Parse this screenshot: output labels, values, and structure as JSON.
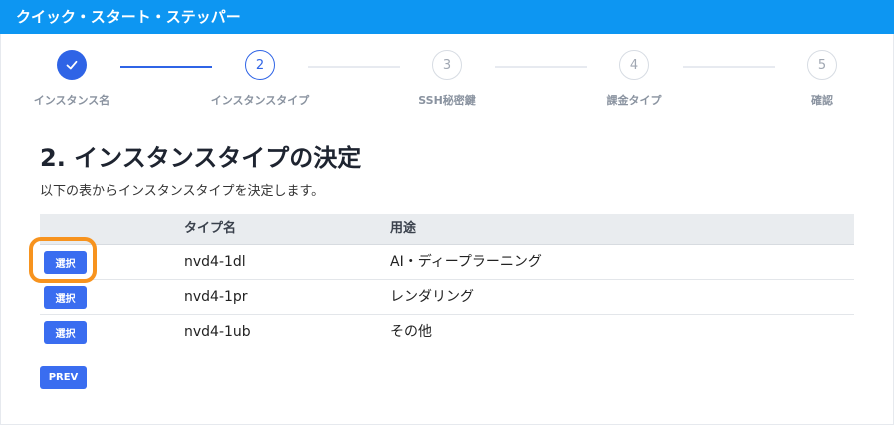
{
  "header": {
    "title": "クイック・スタート・ステッパー"
  },
  "stepper": {
    "steps": [
      {
        "number": "1",
        "label": "インスタンス名",
        "state": "done",
        "icon": "check-icon"
      },
      {
        "number": "2",
        "label": "インスタンスタイプ",
        "state": "active"
      },
      {
        "number": "3",
        "label": "SSH秘密鍵",
        "state": "todo"
      },
      {
        "number": "4",
        "label": "課金タイプ",
        "state": "todo"
      },
      {
        "number": "5",
        "label": "確認",
        "state": "todo"
      }
    ]
  },
  "main": {
    "title": "2. インスタンスタイプの決定",
    "subtitle": "以下の表からインスタンスタイプを決定します。"
  },
  "table": {
    "columns": [
      "",
      "タイプ名",
      "用途"
    ],
    "rows": [
      {
        "button": "選択",
        "type": "nvd4-1dl",
        "usage": "AI・ディープラーニング"
      },
      {
        "button": "選択",
        "type": "nvd4-1pr",
        "usage": "レンダリング"
      },
      {
        "button": "選択",
        "type": "nvd4-1ub",
        "usage": "その他"
      }
    ]
  },
  "footer": {
    "prev_label": "PREV"
  },
  "colors": {
    "header_bg": "#0d96f2",
    "accent": "#2f64e6",
    "button": "#3a6df0",
    "highlight": "#f7931e"
  }
}
